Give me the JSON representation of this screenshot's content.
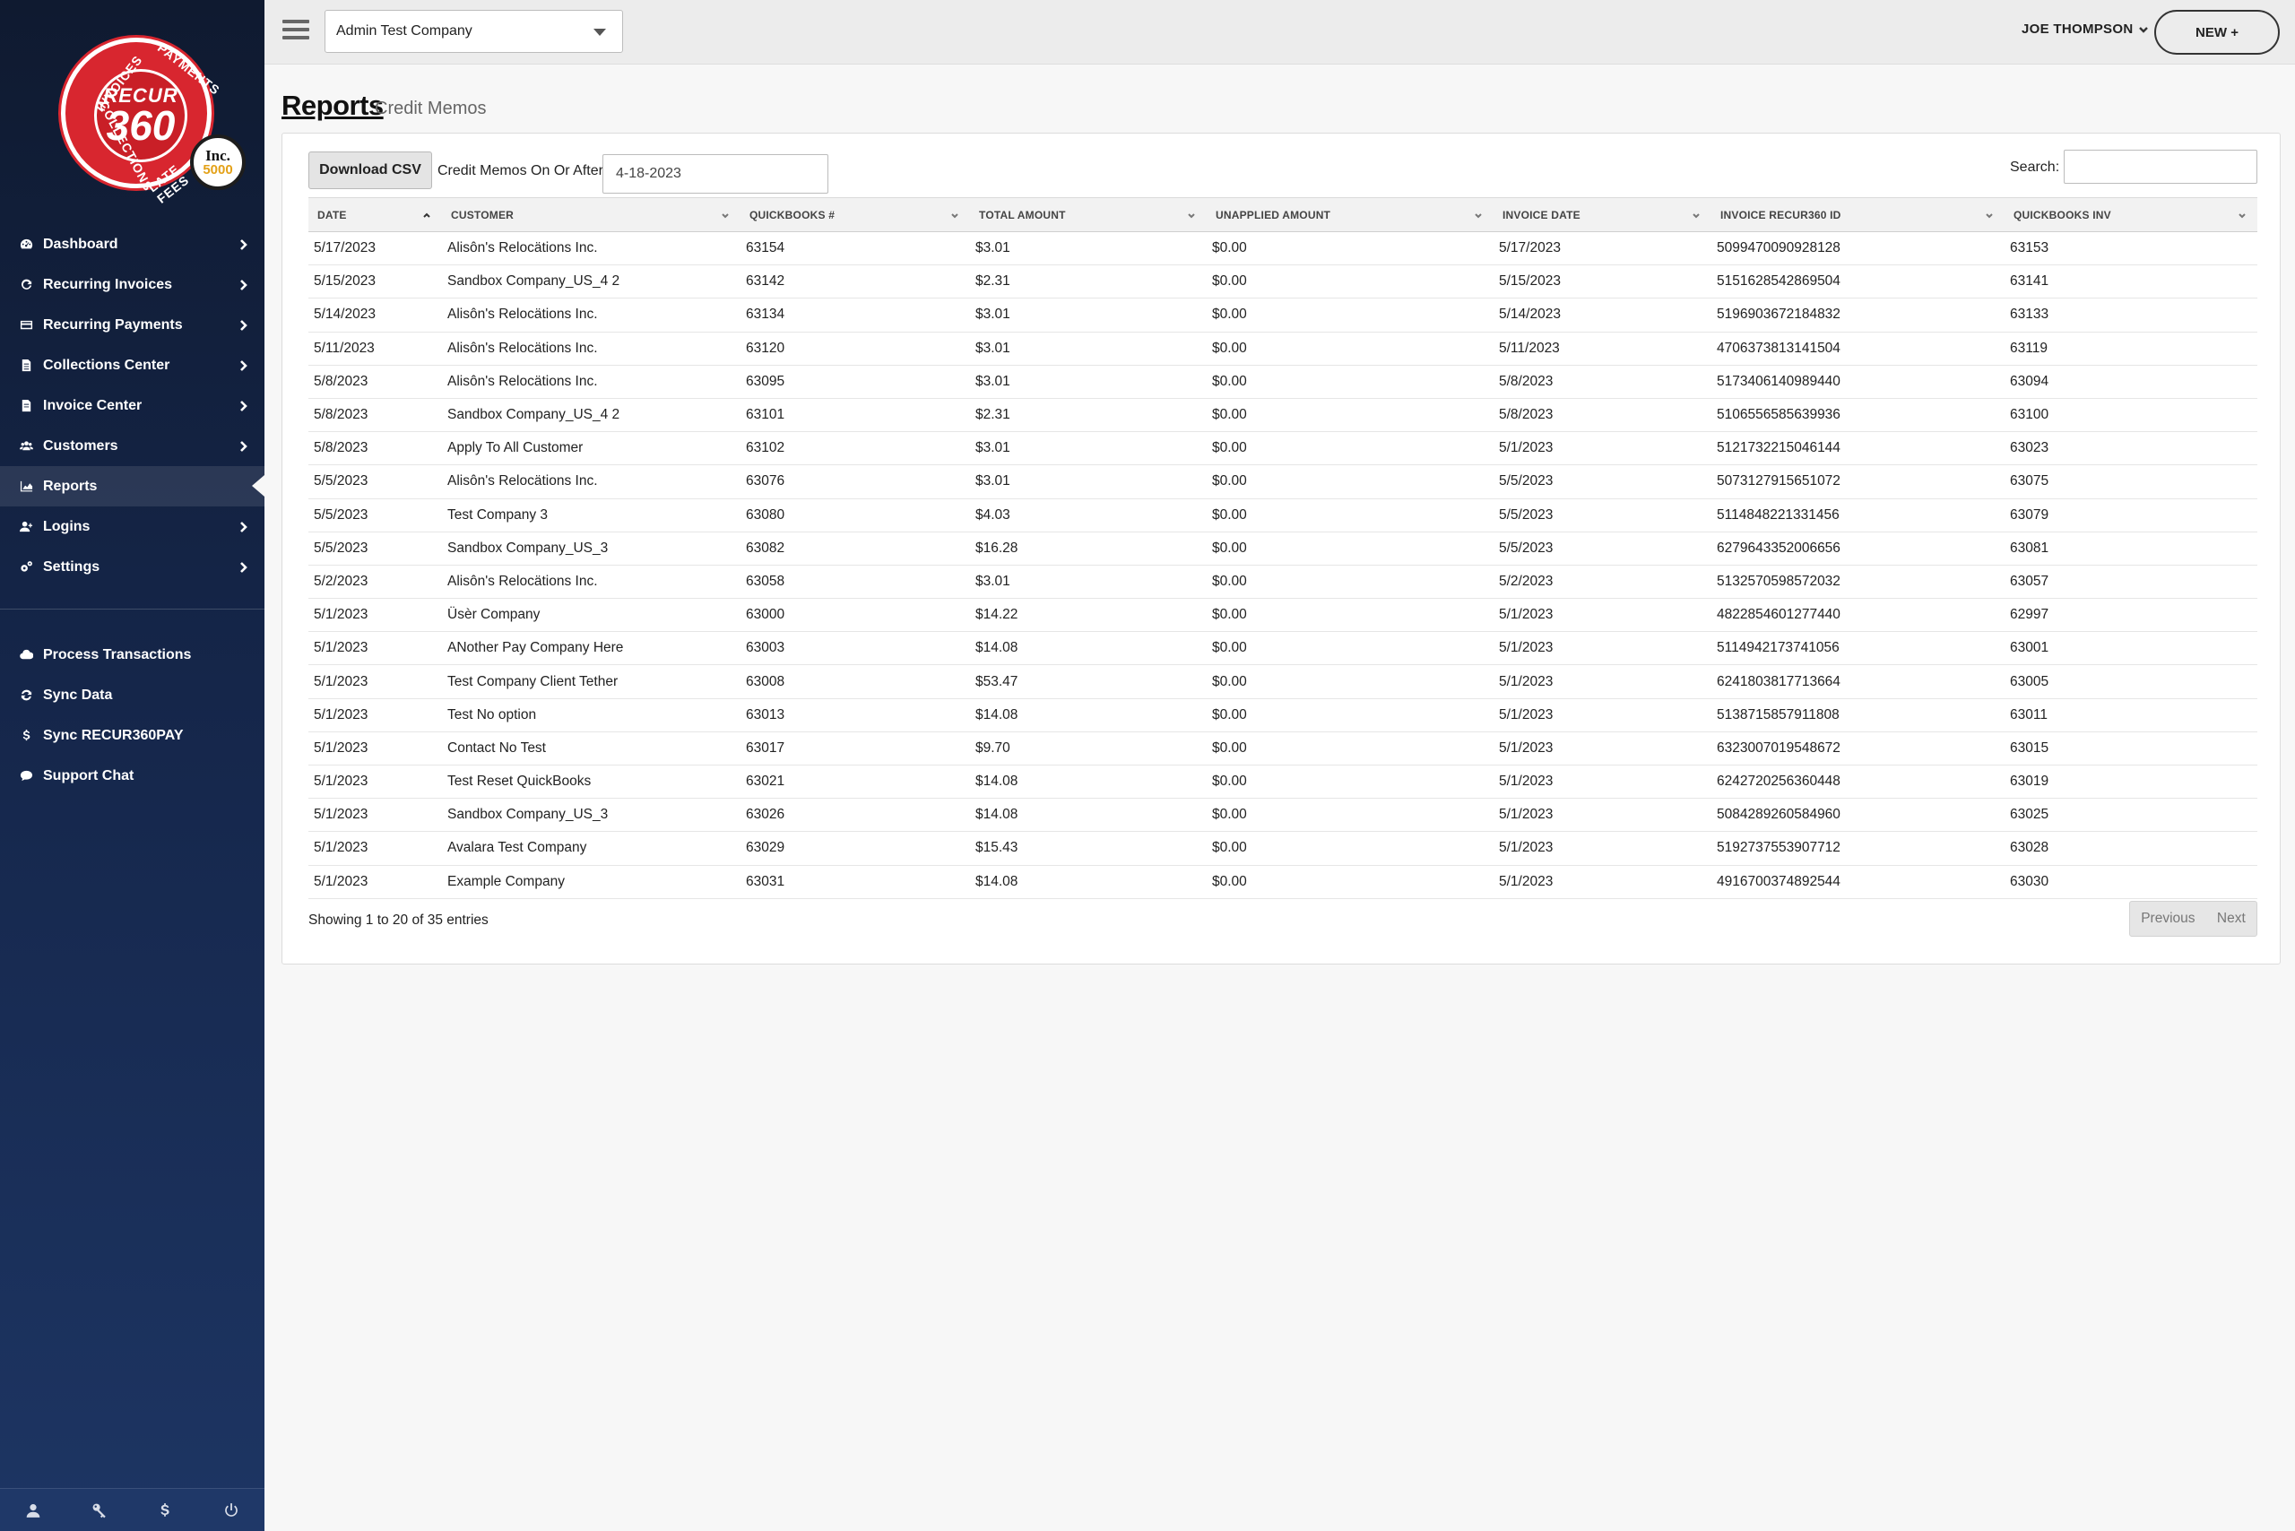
{
  "brand": {
    "logo_recur": "RECUR",
    "logo_360": "360",
    "arc_words": [
      "INVOICES",
      "PAYMENTS",
      "COLLECTIONS",
      "LATE FEES"
    ],
    "badge_text": "Inc.",
    "badge_num": "5000",
    "accent_color": "#d8262f"
  },
  "nav": {
    "items": [
      {
        "label": "Dashboard",
        "icon": "dashboard-icon",
        "chevron": true
      },
      {
        "label": "Recurring Invoices",
        "icon": "refresh-icon",
        "chevron": true
      },
      {
        "label": "Recurring Payments",
        "icon": "credit-card-icon",
        "chevron": true
      },
      {
        "label": "Collections Center",
        "icon": "document-icon",
        "chevron": true
      },
      {
        "label": "Invoice Center",
        "icon": "file-icon",
        "chevron": true
      },
      {
        "label": "Customers",
        "icon": "users-icon",
        "chevron": true
      },
      {
        "label": "Reports",
        "icon": "area-chart-icon",
        "chevron": false,
        "active": true
      },
      {
        "label": "Logins",
        "icon": "user-plus-icon",
        "chevron": true
      },
      {
        "label": "Settings",
        "icon": "cogs-icon",
        "chevron": true
      }
    ],
    "tools": [
      {
        "label": "Process Transactions",
        "icon": "cloud-icon"
      },
      {
        "label": "Sync Data",
        "icon": "sync-icon"
      },
      {
        "label": "Sync RECUR360PAY",
        "icon": "dollar-icon"
      },
      {
        "label": "Support Chat",
        "icon": "chat-icon"
      }
    ],
    "footer_icons": [
      "user-icon",
      "key-icon",
      "dollar-icon",
      "power-icon"
    ]
  },
  "topbar": {
    "company": "Admin Test Company",
    "user": "JOE THOMPSON",
    "new_label": "NEW +"
  },
  "page": {
    "title": "Reports",
    "subtitle": "Credit Memos"
  },
  "toolbar": {
    "download_label": "Download CSV",
    "filter_label": "Credit Memos On Or After:",
    "filter_value": "4-18-2023",
    "search_label": "Search:",
    "search_value": ""
  },
  "table": {
    "columns": [
      "DATE",
      "CUSTOMER",
      "QUICKBOOKS #",
      "TOTAL AMOUNT",
      "UNAPPLIED AMOUNT",
      "INVOICE DATE",
      "INVOICE RECUR360 ID",
      "QUICKBOOKS INV"
    ],
    "rows": [
      [
        "5/17/2023",
        "Alisôn's Relocätions Inc.",
        "63154",
        "$3.01",
        "$0.00",
        "5/17/2023",
        "5099470090928128",
        "63153"
      ],
      [
        "5/15/2023",
        "Sandbox Company_US_4 2",
        "63142",
        "$2.31",
        "$0.00",
        "5/15/2023",
        "5151628542869504",
        "63141"
      ],
      [
        "5/14/2023",
        "Alisôn's Relocätions Inc.",
        "63134",
        "$3.01",
        "$0.00",
        "5/14/2023",
        "5196903672184832",
        "63133"
      ],
      [
        "5/11/2023",
        "Alisôn's Relocätions Inc.",
        "63120",
        "$3.01",
        "$0.00",
        "5/11/2023",
        "4706373813141504",
        "63119"
      ],
      [
        "5/8/2023",
        "Alisôn's Relocätions Inc.",
        "63095",
        "$3.01",
        "$0.00",
        "5/8/2023",
        "5173406140989440",
        "63094"
      ],
      [
        "5/8/2023",
        "Sandbox Company_US_4 2",
        "63101",
        "$2.31",
        "$0.00",
        "5/8/2023",
        "5106556585639936",
        "63100"
      ],
      [
        "5/8/2023",
        "Apply To All Customer",
        "63102",
        "$3.01",
        "$0.00",
        "5/1/2023",
        "5121732215046144",
        "63023"
      ],
      [
        "5/5/2023",
        "Alisôn's Relocätions Inc.",
        "63076",
        "$3.01",
        "$0.00",
        "5/5/2023",
        "5073127915651072",
        "63075"
      ],
      [
        "5/5/2023",
        "Test Company 3",
        "63080",
        "$4.03",
        "$0.00",
        "5/5/2023",
        "5114848221331456",
        "63079"
      ],
      [
        "5/5/2023",
        "Sandbox Company_US_3",
        "63082",
        "$16.28",
        "$0.00",
        "5/5/2023",
        "6279643352006656",
        "63081"
      ],
      [
        "5/2/2023",
        "Alisôn's Relocätions Inc.",
        "63058",
        "$3.01",
        "$0.00",
        "5/2/2023",
        "5132570598572032",
        "63057"
      ],
      [
        "5/1/2023",
        "Üsèr Company",
        "63000",
        "$14.22",
        "$0.00",
        "5/1/2023",
        "4822854601277440",
        "62997"
      ],
      [
        "5/1/2023",
        "ANother Pay Company Here",
        "63003",
        "$14.08",
        "$0.00",
        "5/1/2023",
        "5114942173741056",
        "63001"
      ],
      [
        "5/1/2023",
        "Test Company Client Tether",
        "63008",
        "$53.47",
        "$0.00",
        "5/1/2023",
        "6241803817713664",
        "63005"
      ],
      [
        "5/1/2023",
        "Test No option",
        "63013",
        "$14.08",
        "$0.00",
        "5/1/2023",
        "5138715857911808",
        "63011"
      ],
      [
        "5/1/2023",
        "Contact No Test",
        "63017",
        "$9.70",
        "$0.00",
        "5/1/2023",
        "6323007019548672",
        "63015"
      ],
      [
        "5/1/2023",
        "Test Reset QuickBooks",
        "63021",
        "$14.08",
        "$0.00",
        "5/1/2023",
        "6242720256360448",
        "63019"
      ],
      [
        "5/1/2023",
        "Sandbox Company_US_3",
        "63026",
        "$14.08",
        "$0.00",
        "5/1/2023",
        "5084289260584960",
        "63025"
      ],
      [
        "5/1/2023",
        "Avalara Test Company",
        "63029",
        "$15.43",
        "$0.00",
        "5/1/2023",
        "5192737553907712",
        "63028"
      ],
      [
        "5/1/2023",
        "Example Company",
        "63031",
        "$14.08",
        "$0.00",
        "5/1/2023",
        "4916700374892544",
        "63030"
      ]
    ]
  },
  "footer": {
    "showing": "Showing 1 to 20 of 35 entries",
    "previous": "Previous",
    "next": "Next"
  }
}
